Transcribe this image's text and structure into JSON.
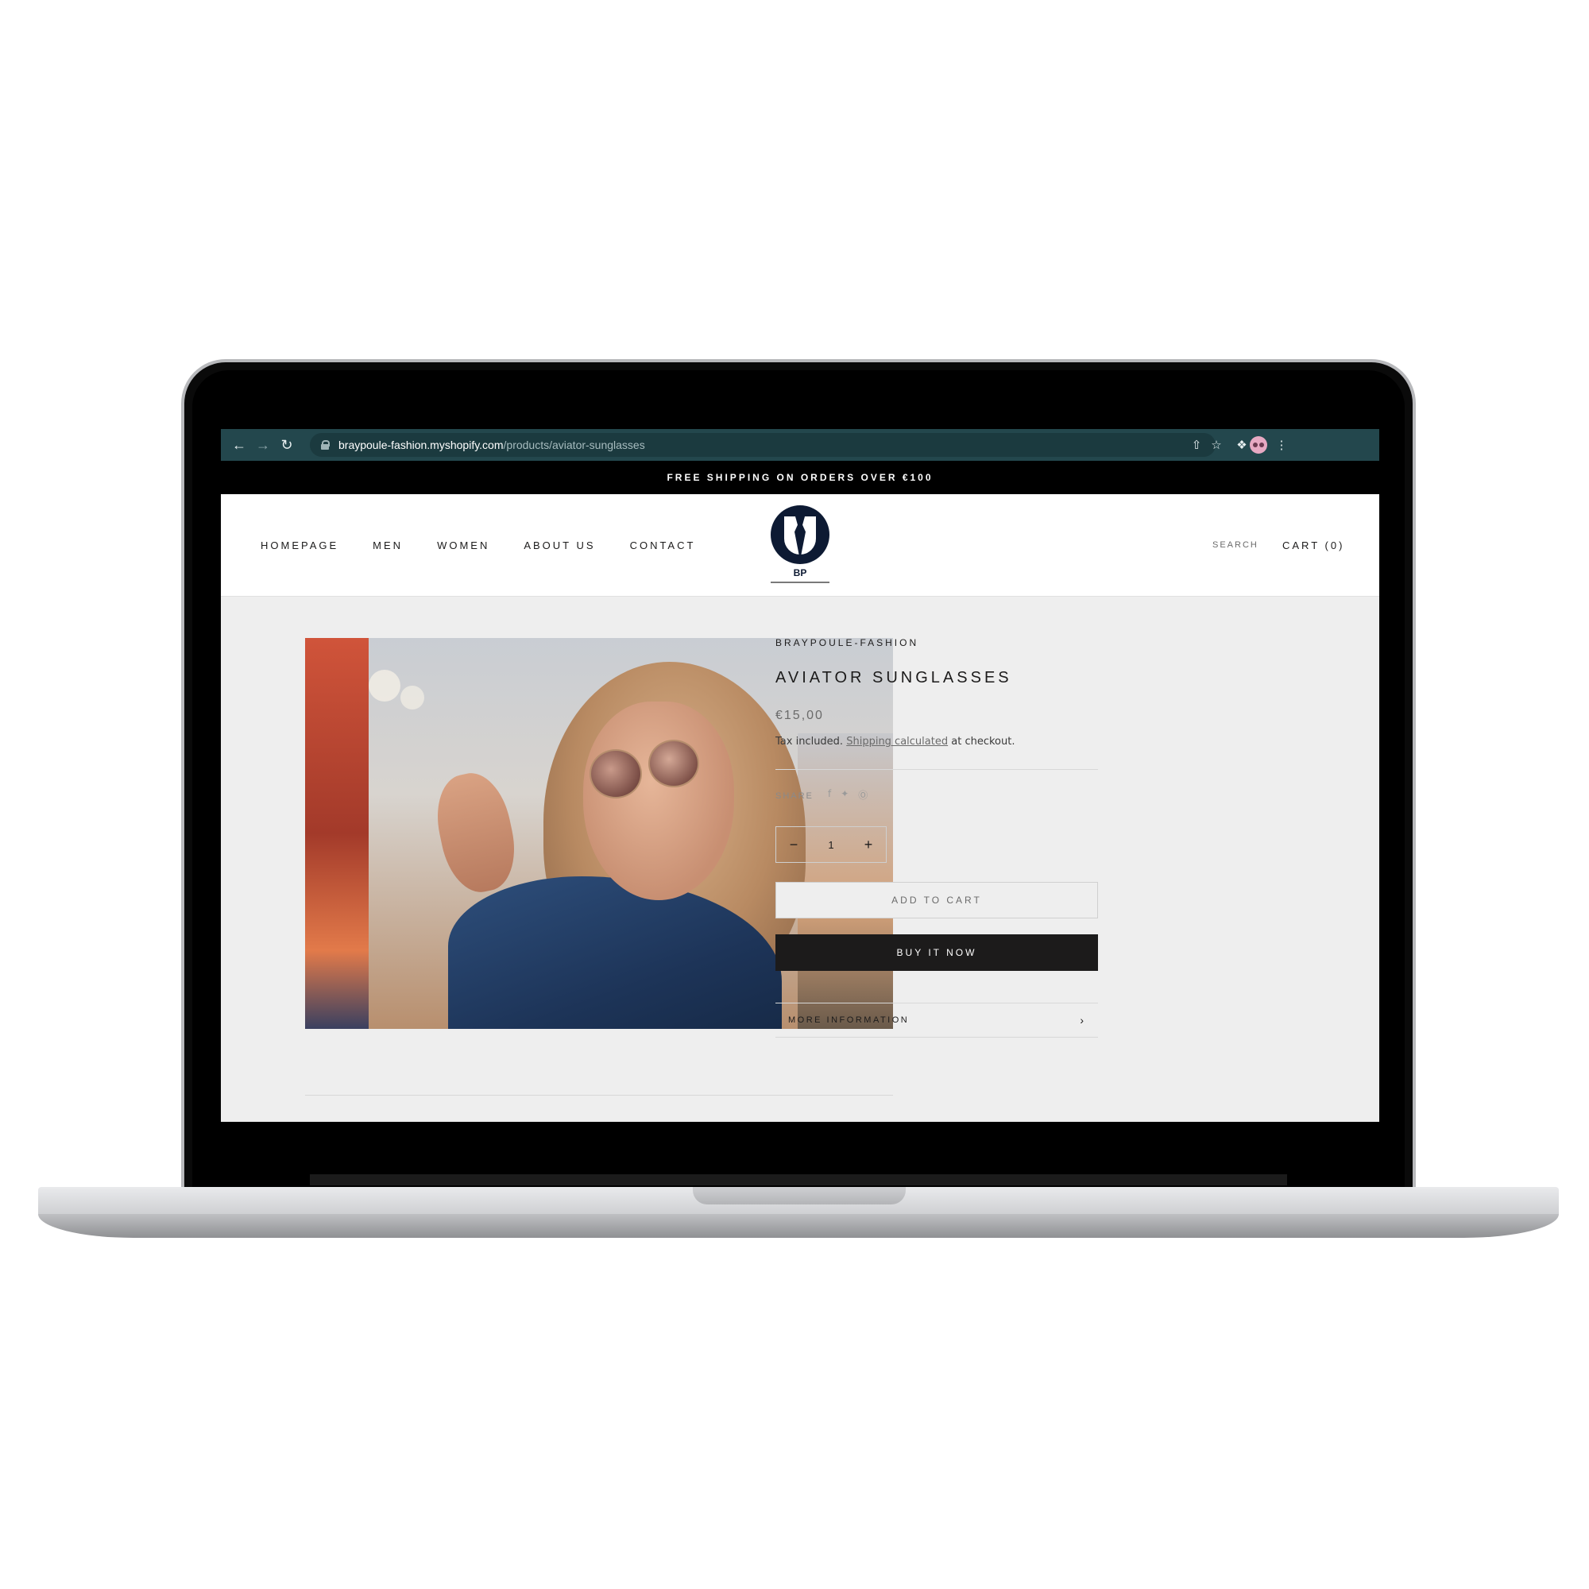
{
  "browser": {
    "url_host": "braypoule-fashion.myshopify.com",
    "url_path": "/products/aviator-sunglasses"
  },
  "announcement": "FREE SHIPPING ON ORDERS OVER €100",
  "nav": {
    "items": [
      "HOMEPAGE",
      "MEN",
      "WOMEN",
      "ABOUT US",
      "CONTACT"
    ],
    "search": "SEARCH",
    "cart": "CART (0)"
  },
  "logo": {
    "text": "BP"
  },
  "product": {
    "vendor": "BRAYPOULE-FASHION",
    "title": "AVIATOR SUNGLASSES",
    "price": "€15,00",
    "tax_prefix": "Tax included.",
    "shipping_link": "Shipping calculated",
    "tax_suffix": "at checkout.",
    "share_label": "SHARE",
    "quantity": "1",
    "add_to_cart": "ADD TO CART",
    "buy_now": "BUY IT NOW",
    "more_info": "MORE INFORMATION"
  },
  "colors": {
    "browser_bar": "#23474d",
    "announcement_bg": "#000000",
    "buy_button_bg": "#1c1b1b",
    "page_bg": "#eeeeee"
  }
}
